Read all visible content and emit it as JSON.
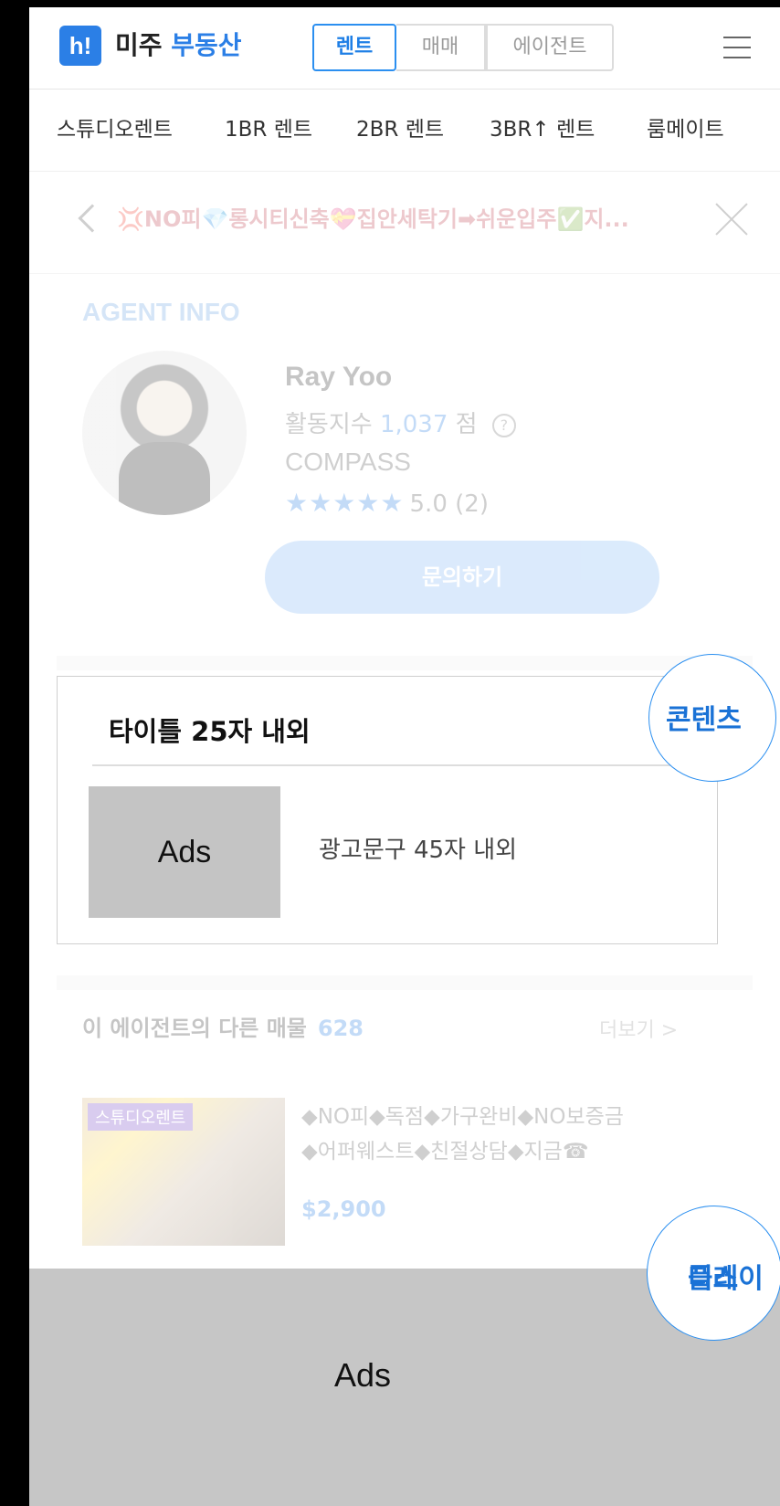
{
  "header": {
    "logo_mark": "h!",
    "logo_text_primary": "미주",
    "logo_text_accent": "부동산",
    "tabs": [
      "렌트",
      "매매",
      "에이전트"
    ],
    "active_tab": "렌트",
    "accent_color": "#2b7fe6"
  },
  "category_nav": {
    "items": [
      "스튜디오렌트",
      "1BR 렌트",
      "2BR 렌트",
      "3BR↑ 렌트",
      "룸메이트"
    ]
  },
  "listing": {
    "title": "💢NO피💎롱시티신축💝집안세탁기➡쉬운입주✅지..."
  },
  "agent": {
    "heading": "AGENT INFO",
    "name": "Ray Yoo",
    "activity_label": "활동지수",
    "activity_score": "1,037",
    "activity_unit": "점",
    "help_glyph": "?",
    "company": "COMPASS",
    "stars": "★★★★★",
    "rating_text": "5.0 (2)",
    "rating_value": 5.0,
    "rating_max": 5,
    "inquiry_button": "문의하기"
  },
  "native_ad": {
    "title": "타이틀 25자 내외",
    "image_label": "Ads",
    "copy": "광고문구 45자 내외"
  },
  "other_listings": {
    "heading": "이 에이전트의 다른 매물",
    "count": "628",
    "more_link": "더보기 >",
    "items": [
      {
        "tag": "스튜디오렌트",
        "line1": "◆NO피◆독점◆가구완비◆NO보증금",
        "line2": "◆어퍼웨스트◆친절상담◆지금☎",
        "price": "$2,900"
      }
    ]
  },
  "display_ad": {
    "label": "Ads"
  },
  "annotations": {
    "content_label": "콘텐츠",
    "display_label_line1": "디스",
    "display_label_line2": "플레이"
  }
}
